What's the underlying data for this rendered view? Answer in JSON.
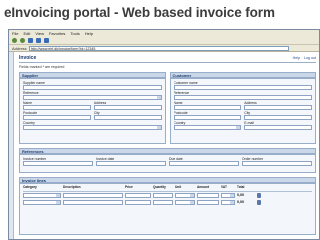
{
  "slide": {
    "title": "eInvoicing portal - Web based invoice form"
  },
  "browser": {
    "menu": [
      "File",
      "Edit",
      "View",
      "Favorites",
      "Tools",
      "Help"
    ],
    "address_label": "Address",
    "url": "http://www.ehf.dk/invoice/form?id=12345"
  },
  "page": {
    "header": "Invoice",
    "links": [
      "Help",
      "Log out"
    ],
    "notice": "Fields marked * are required",
    "supplier": {
      "title": "Supplier",
      "fields": [
        {
          "label": "Supplier name",
          "value": ""
        },
        {
          "label": "Reference",
          "value": ""
        },
        {
          "label": "Name",
          "value": ""
        },
        {
          "label": "Address",
          "value": ""
        },
        {
          "label": "Postcode",
          "value": ""
        },
        {
          "label": "City",
          "value": ""
        },
        {
          "label": "Country",
          "value": ""
        }
      ]
    },
    "customer": {
      "title": "Customer",
      "fields": [
        {
          "label": "Customer name",
          "value": ""
        },
        {
          "label": "Reference",
          "value": ""
        },
        {
          "label": "Name",
          "value": ""
        },
        {
          "label": "Address",
          "value": ""
        },
        {
          "label": "Postcode",
          "value": ""
        },
        {
          "label": "City",
          "value": ""
        },
        {
          "label": "Country",
          "value": ""
        },
        {
          "label": "E-mail",
          "value": ""
        }
      ]
    },
    "references": {
      "title": "References",
      "fields": [
        {
          "label": "Invoice number",
          "value": ""
        },
        {
          "label": "Invoice date",
          "value": ""
        },
        {
          "label": "Due date",
          "value": ""
        },
        {
          "label": "Order number",
          "value": ""
        }
      ]
    },
    "lines": {
      "title": "Invoice lines",
      "headers": [
        "Category",
        "Description",
        "Price",
        "Quantity",
        "Unit",
        "Amount",
        "VAT",
        "Total"
      ],
      "select_placeholder": "",
      "rows": [
        {
          "amount": "0,00"
        },
        {
          "amount": "0,00"
        }
      ]
    }
  }
}
